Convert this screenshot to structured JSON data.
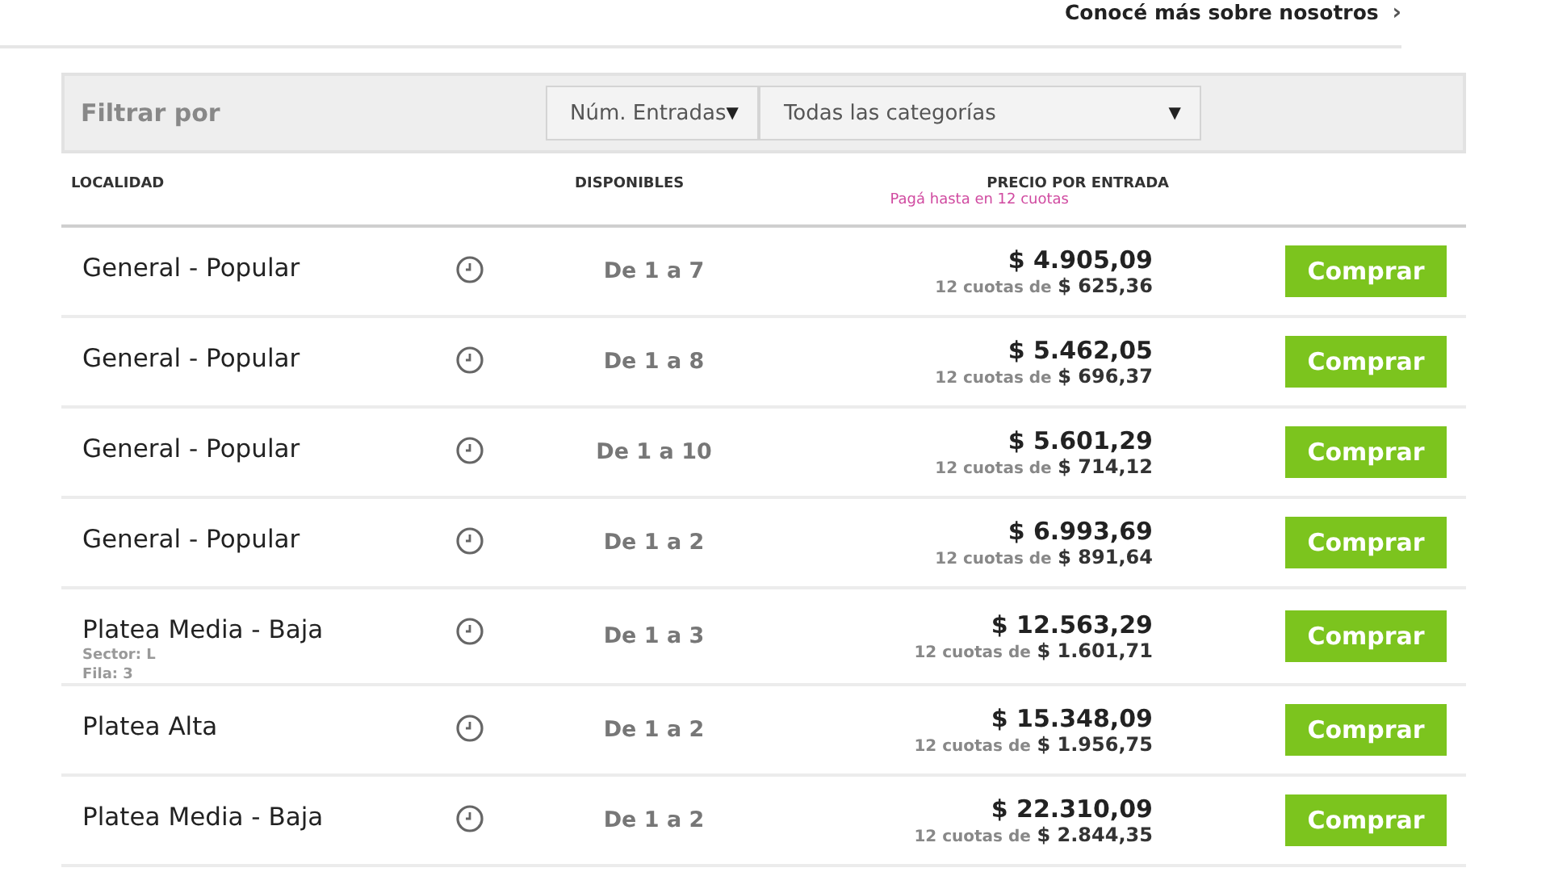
{
  "top_link": {
    "label": "Conocé más sobre nosotros",
    "chevron": "›"
  },
  "filter": {
    "label": "Filtrar por",
    "selects": [
      {
        "value": "Núm. Entradas",
        "caret": "▼"
      },
      {
        "value": "Todas las categorías",
        "caret": "▼"
      }
    ]
  },
  "columns": {
    "location": "LOCALIDAD",
    "available": "DISPONIBLES",
    "price": "PRECIO POR ENTRADA",
    "price_note": "Pagá hasta en 12 cuotas"
  },
  "rows": [
    {
      "name": "General - Popular",
      "available": "De 1 a 7",
      "price": "$ 4.905,09",
      "installments_label": "12 cuotas de",
      "installment": "$ 625,36",
      "button": "Comprar"
    },
    {
      "name": "General - Popular",
      "available": "De 1 a 8",
      "price": "$ 5.462,05",
      "installments_label": "12 cuotas de",
      "installment": "$ 696,37",
      "button": "Comprar"
    },
    {
      "name": "General - Popular",
      "available": "De 1 a 10",
      "price": "$ 5.601,29",
      "installments_label": "12 cuotas de",
      "installment": "$ 714,12",
      "button": "Comprar"
    },
    {
      "name": "General - Popular",
      "available": "De 1 a 2",
      "price": "$ 6.993,69",
      "installments_label": "12 cuotas de",
      "installment": "$ 891,64",
      "button": "Comprar"
    },
    {
      "name": "Platea Media - Baja",
      "details": [
        "Sector: L",
        "Fila: 3"
      ],
      "available": "De 1 a 3",
      "price": "$ 12.563,29",
      "installments_label": "12 cuotas de",
      "installment": "$ 1.601,71",
      "button": "Comprar"
    },
    {
      "name": "Platea Alta",
      "available": "De 1 a 2",
      "price": "$ 15.348,09",
      "installments_label": "12 cuotas de",
      "installment": "$ 1.956,75",
      "button": "Comprar"
    },
    {
      "name": "Platea Media - Baja",
      "available": "De 1 a 2",
      "price": "$ 22.310,09",
      "installments_label": "12 cuotas de",
      "installment": "$ 2.844,35",
      "button": "Comprar"
    }
  ]
}
